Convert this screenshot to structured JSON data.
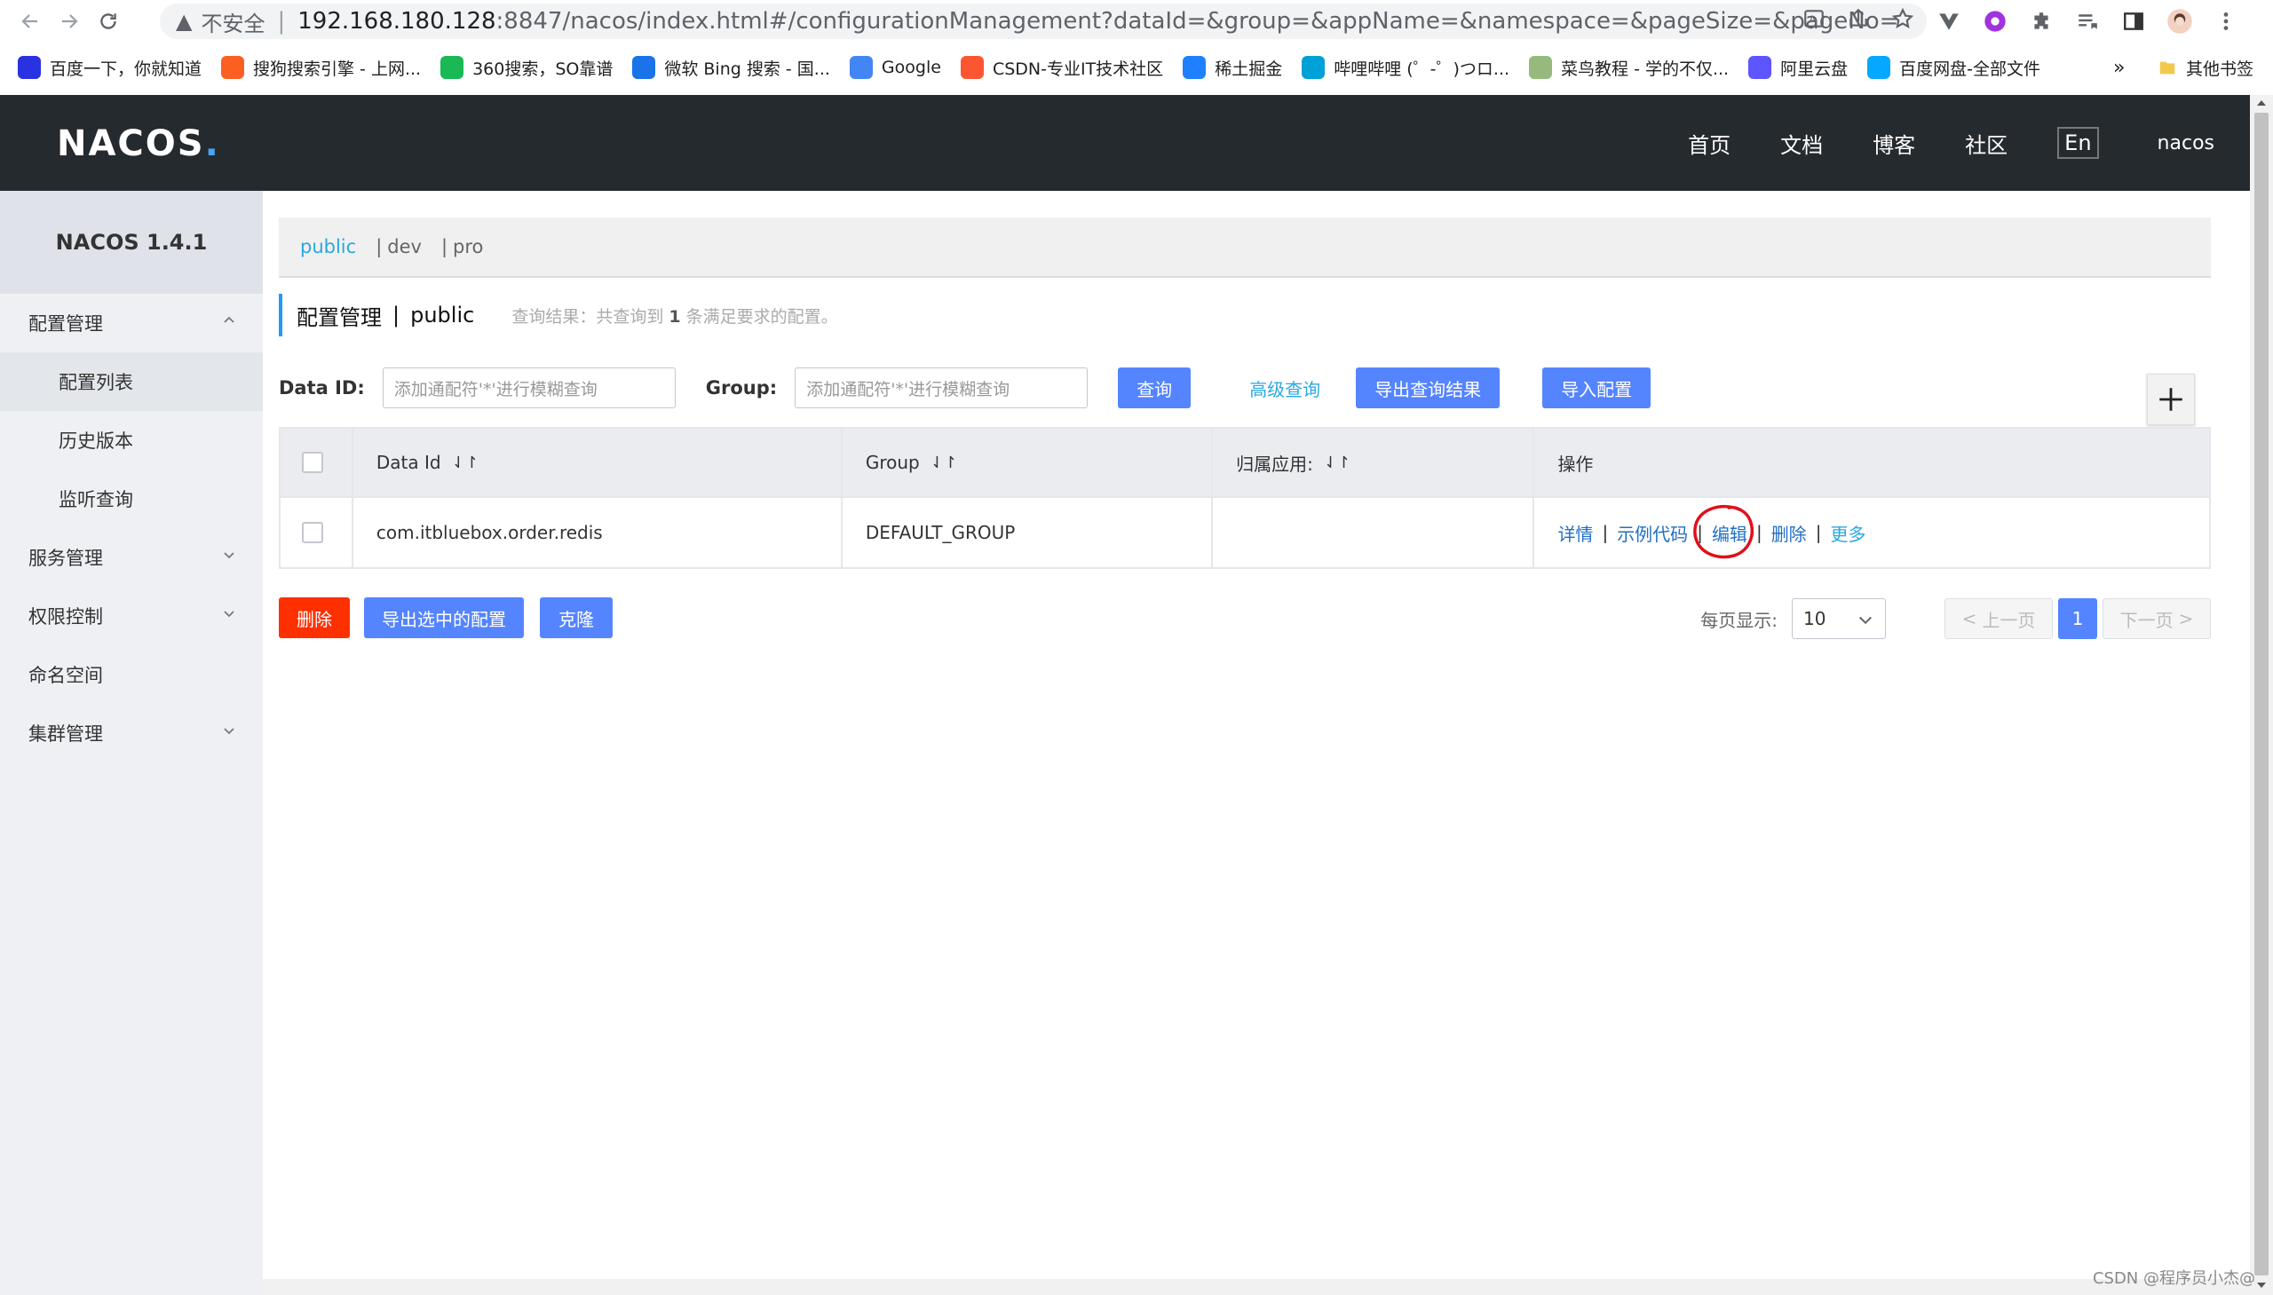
{
  "browser": {
    "insecure_label": "不安全",
    "url_host": "192.168.180.128",
    "url_rest": ":8847/nacos/index.html#/configurationManagement?dataId=&group=&appName=&namespace=&pageSize=&pageNo=",
    "bookmarks": [
      {
        "label": "百度一下，你就知道",
        "icon": "baidu-icon",
        "color": "#2932e1"
      },
      {
        "label": "搜狗搜索引擎 - 上网...",
        "icon": "sogou-icon",
        "color": "#fb6022"
      },
      {
        "label": "360搜索，SO靠谱",
        "icon": "360-icon",
        "color": "#19b955"
      },
      {
        "label": "微软 Bing 搜索 - 国...",
        "icon": "bing-icon",
        "color": "#1a73e8"
      },
      {
        "label": "Google",
        "icon": "google-icon",
        "color": "#4285f4"
      },
      {
        "label": "CSDN-专业IT技术社区",
        "icon": "csdn-icon",
        "color": "#fc5531"
      },
      {
        "label": "稀土掘金",
        "icon": "juejin-icon",
        "color": "#1e80ff"
      },
      {
        "label": "哔哩哔哩 (゜-゜)つロ...",
        "icon": "bilibili-icon",
        "color": "#00a1d6"
      },
      {
        "label": "菜鸟教程 - 学的不仅...",
        "icon": "runoob-icon",
        "color": "#96b97d"
      },
      {
        "label": "阿里云盘",
        "icon": "aliyun-drive-icon",
        "color": "#5d55ff"
      },
      {
        "label": "百度网盘-全部文件",
        "icon": "baidu-pan-icon",
        "color": "#06a7ff"
      }
    ],
    "more_label": "»",
    "other_bookmarks": "其他书签"
  },
  "header": {
    "logo": "NACOS.",
    "nav": [
      "首页",
      "文档",
      "博客",
      "社区"
    ],
    "lang": "En",
    "user": "nacos"
  },
  "sidebar": {
    "title": "NACOS 1.4.1",
    "groups": [
      {
        "label": "配置管理",
        "expanded": true,
        "items": [
          "配置列表",
          "历史版本",
          "监听查询"
        ]
      },
      {
        "label": "服务管理",
        "expanded": false
      },
      {
        "label": "权限控制",
        "expanded": false
      },
      {
        "label": "命名空间"
      },
      {
        "label": "集群管理",
        "expanded": false
      }
    ]
  },
  "namespaces": [
    "public",
    "dev",
    "pro"
  ],
  "title": {
    "main": "配置管理",
    "sep": "|",
    "ns": "public",
    "hint_pre": "查询结果：共查询到 ",
    "hint_count": "1",
    "hint_post": " 条满足要求的配置。"
  },
  "search": {
    "dataid_label": "Data ID:",
    "dataid_placeholder": "添加通配符'*'进行模糊查询",
    "group_label": "Group:",
    "group_placeholder": "添加通配符'*'进行模糊查询",
    "query_btn": "查询",
    "advanced_link": "高级查询",
    "export_result_btn": "导出查询结果",
    "import_btn": "导入配置"
  },
  "table": {
    "headers": {
      "data_id": "Data Id",
      "group": "Group",
      "app": "归属应用:",
      "ops": "操作"
    },
    "rows": [
      {
        "data_id": "com.itbluebox.order.redis",
        "group": "DEFAULT_GROUP",
        "app": ""
      }
    ],
    "ops": {
      "detail": "详情",
      "sample": "示例代码",
      "edit": "编辑",
      "delete": "删除",
      "more": "更多",
      "sep": "|"
    }
  },
  "footer_actions": {
    "delete_btn": "删除",
    "export_selected_btn": "导出选中的配置",
    "clone_btn": "克隆"
  },
  "pagination": {
    "page_size_label": "每页显示:",
    "page_size": "10",
    "prev": "上一页",
    "current": "1",
    "next": "下一页"
  },
  "watermark": "CSDN @程序员小杰@",
  "colors": {
    "primary": "#5584ff",
    "link": "#29a8e0",
    "danger": "#ff3000",
    "header_bg": "#252a2f",
    "annotation": "#e0101c"
  }
}
